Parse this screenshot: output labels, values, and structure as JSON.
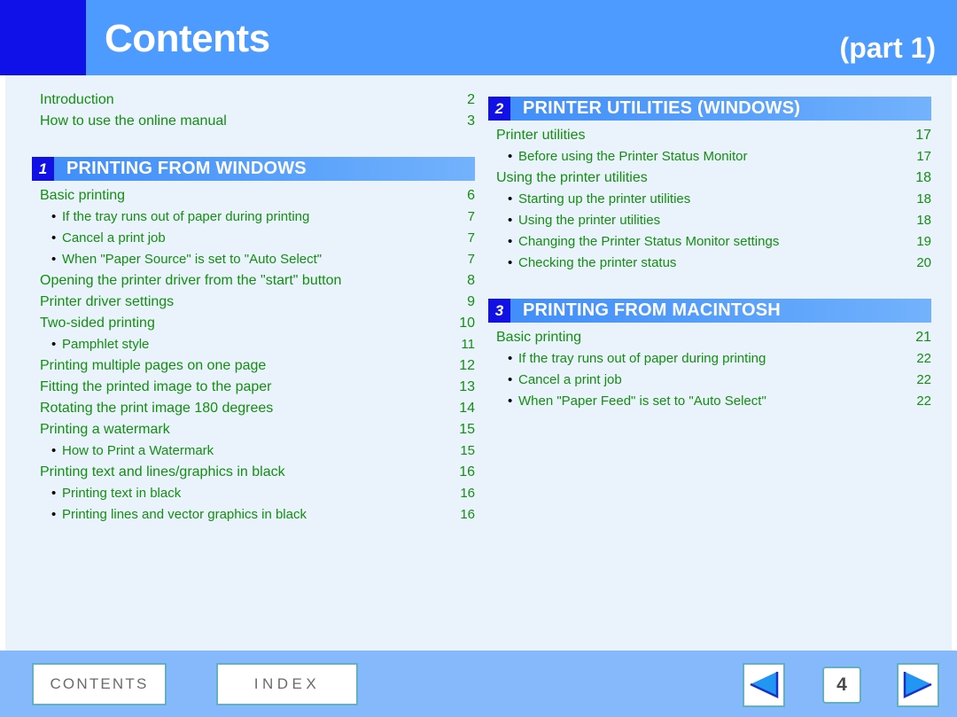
{
  "header": {
    "title": "Contents",
    "part": "(part 1)",
    "accent_block_color": "#1010e8",
    "bar_color": "#4d9bff"
  },
  "colors": {
    "canvas": "#eaf2fc",
    "toc_text": "#12900f",
    "section_bar": "#4d9bff",
    "section_num_bg": "#1111e6",
    "footer_bar": "#86b9fb",
    "button_border": "#63b0c4",
    "arrow_fill": "#2196f3",
    "arrow_outline": "#1a31c8"
  },
  "left_column": {
    "intro_items": [
      {
        "label": "Introduction",
        "page": "2",
        "sub": false
      },
      {
        "label": "How to use the online manual",
        "page": "3",
        "sub": false
      }
    ],
    "section": {
      "number": "1",
      "title": "PRINTING FROM WINDOWS",
      "items": [
        {
          "label": "Basic printing",
          "page": "6",
          "sub": false
        },
        {
          "label": "If the tray runs out of paper during printing",
          "page": "7",
          "sub": true
        },
        {
          "label": "Cancel a print job",
          "page": "7",
          "sub": true
        },
        {
          "label": "When \"Paper Source\" is set to \"Auto Select\"",
          "page": "7",
          "sub": true
        },
        {
          "label": "Opening the printer driver from the \"start\" button",
          "page": "8",
          "sub": false
        },
        {
          "label": "Printer driver settings",
          "page": "9",
          "sub": false
        },
        {
          "label": "Two-sided printing",
          "page": "10",
          "sub": false
        },
        {
          "label": "Pamphlet style",
          "page": "11",
          "sub": true
        },
        {
          "label": "Printing multiple pages on one page",
          "page": "12",
          "sub": false
        },
        {
          "label": "Fitting the printed image to the paper",
          "page": "13",
          "sub": false
        },
        {
          "label": "Rotating the print image 180 degrees",
          "page": "14",
          "sub": false
        },
        {
          "label": "Printing a watermark",
          "page": "15",
          "sub": false
        },
        {
          "label": "How to Print a Watermark",
          "page": "15",
          "sub": true
        },
        {
          "label": "Printing text and lines/graphics in black",
          "page": "16",
          "sub": false
        },
        {
          "label": "Printing text in black",
          "page": "16",
          "sub": true
        },
        {
          "label": "Printing lines and vector graphics in black",
          "page": "16",
          "sub": true
        }
      ]
    }
  },
  "right_column": {
    "section_2": {
      "number": "2",
      "title": "PRINTER UTILITIES (WINDOWS)",
      "items": [
        {
          "label": "Printer utilities",
          "page": "17",
          "sub": false
        },
        {
          "label": "Before using the Printer Status Monitor",
          "page": "17",
          "sub": true
        },
        {
          "label": "Using the printer utilities",
          "page": "18",
          "sub": false
        },
        {
          "label": "Starting up the printer utilities",
          "page": "18",
          "sub": true
        },
        {
          "label": "Using the printer utilities",
          "page": "18",
          "sub": true
        },
        {
          "label": "Changing the Printer Status Monitor settings",
          "page": "19",
          "sub": true
        },
        {
          "label": "Checking the printer status",
          "page": "20",
          "sub": true
        }
      ]
    },
    "section_3": {
      "number": "3",
      "title": "PRINTING FROM MACINTOSH",
      "items": [
        {
          "label": "Basic printing",
          "page": "21",
          "sub": false
        },
        {
          "label": "If the tray runs out of paper during printing",
          "page": "22",
          "sub": true
        },
        {
          "label": "Cancel a print job",
          "page": "22",
          "sub": true
        },
        {
          "label": "When \"Paper Feed\" is set to \"Auto Select\"",
          "page": "22",
          "sub": true
        }
      ]
    }
  },
  "footer": {
    "contents_label": "CONTENTS",
    "index_label": "INDEX",
    "page_number": "4",
    "prev_icon": "left-triangle-icon",
    "next_icon": "right-triangle-icon"
  }
}
